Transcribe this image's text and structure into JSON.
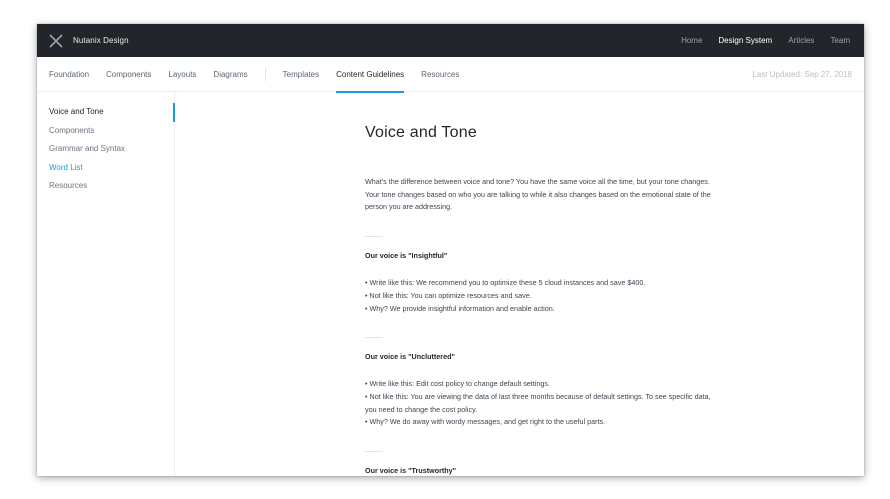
{
  "header": {
    "brand": "Nutanix Design",
    "nav": [
      "Home",
      "Design System",
      "Articles",
      "Team"
    ],
    "active_nav": "Design System"
  },
  "subnav": {
    "items": [
      "Foundation",
      "Components",
      "Layouts",
      "Diagrams",
      "Templates",
      "Content Guidelines",
      "Resources"
    ],
    "active": "Content Guidelines",
    "updated": "Last Updated: Sep 27, 2018"
  },
  "sidebar": {
    "items": [
      "Voice and Tone",
      "Components",
      "Grammar and Syntax",
      "Word List",
      "Resources"
    ],
    "active": "Voice and Tone",
    "link": "Word List"
  },
  "content": {
    "title": "Voice and Tone",
    "intro": "What's the difference between voice and tone? You have the same voice all the time, but your tone changes. Your tone changes based on who you are talking to while it also changes based on the emotional state of the person you are addressing.",
    "sections": [
      {
        "title": "Our voice is \"Insightful\"",
        "bullets": [
          "• Write like this: We recommend you to optimize these 5 cloud instances and save $400.",
          "• Not like this: You can optimize resources and save.",
          "• Why? We provide insightful information and enable action."
        ]
      },
      {
        "title": "Our voice is \"Uncluttered\"",
        "bullets": [
          "• Write like this: Edit cost policy to change default settings.",
          "• Not like this: You are viewing the data of last three months because of default settings. To see specific data, you need to change the cost policy.",
          "• Why? We do away with wordy messages, and get right to the useful parts."
        ]
      },
      {
        "title": "Our voice is \"Trustworthy\"",
        "bullets": []
      }
    ]
  },
  "colors": {
    "topbar": "#22262b",
    "accent": "#1b9bd8"
  }
}
